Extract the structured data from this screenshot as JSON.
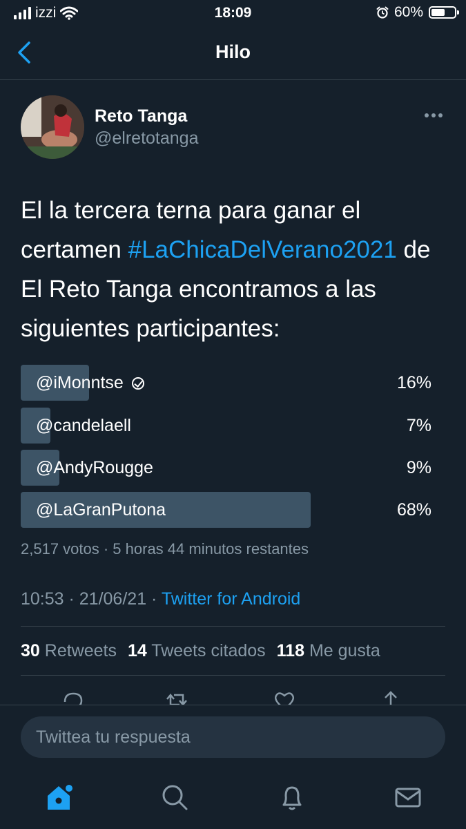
{
  "status_bar": {
    "carrier": "izzi",
    "time": "18:09",
    "battery_percent": "60%",
    "battery_level": 0.6
  },
  "header": {
    "title": "Hilo",
    "back_icon": "chevron-left-icon"
  },
  "tweet": {
    "author_name": "Reto Tanga",
    "author_handle": "@elretotanga",
    "text_before": "El la tercera terna para ganar el certamen ",
    "hashtag": "#LaChicaDelVerano2021",
    "text_after": " de El Reto Tanga encontramos a las siguientes participantes:",
    "poll": {
      "options": [
        {
          "label": "@iMonntse",
          "percent": "16%",
          "value": 16
        },
        {
          "label": "@candelaell",
          "percent": "7%",
          "value": 7
        },
        {
          "label": "@AndyRougge",
          "percent": "9%",
          "value": 9
        },
        {
          "label": "@LaGranPutona",
          "percent": "68%",
          "value": 68
        }
      ],
      "meta": "2,517 votos · 5 horas 44 minutos restantes"
    },
    "time": "10:53 · 21/06/21 · ",
    "source": "Twitter for Android",
    "stats": {
      "retweets_count": "30",
      "retweets_label": "Retweets",
      "quotes_count": "14",
      "quotes_label": "Tweets citados",
      "likes_count": "118",
      "likes_label": "Me gusta"
    }
  },
  "reply": {
    "placeholder": "Twittea tu respuesta"
  },
  "tabbar": [
    "home-icon",
    "search-icon",
    "notifications-icon",
    "messages-icon"
  ],
  "colors": {
    "background": "#15202b",
    "accent": "#1da1f2",
    "secondary_text": "#8899a6",
    "poll_bar": "#3d5466"
  }
}
